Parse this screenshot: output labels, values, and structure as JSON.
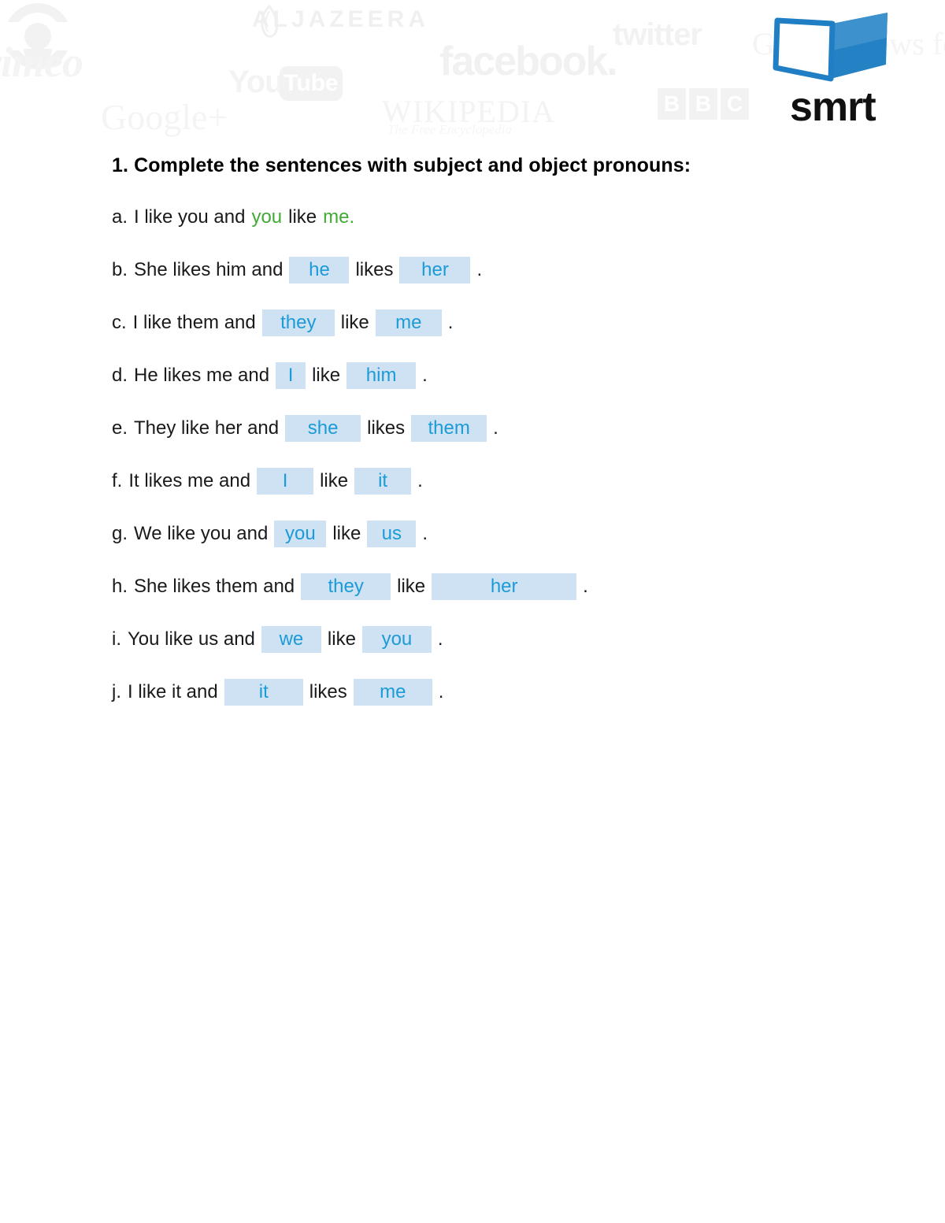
{
  "logo": {
    "brand": "smrt",
    "book_colors": {
      "left_page": "#ffffff",
      "outline": "#1f7ec4",
      "right_page": "#1f7ec4",
      "right_page_shade": "#3d92ce"
    }
  },
  "watermarks": [
    {
      "name": "vimeo",
      "text": "vimeo"
    },
    {
      "name": "cbc",
      "text": ""
    },
    {
      "name": "aljazeera",
      "text": "ALJAZEERA"
    },
    {
      "name": "youtube",
      "text": "You",
      "badge": "Tube"
    },
    {
      "name": "googleplus",
      "text": "Google+"
    },
    {
      "name": "wikipedia",
      "text": "WIKIPEDIA",
      "subtitle": "The Free Encyclopedia"
    },
    {
      "name": "facebook",
      "text": "facebook."
    },
    {
      "name": "twitter",
      "text": "twitter"
    },
    {
      "name": "googlenews",
      "text": "Google News for B"
    },
    {
      "name": "bbc",
      "letters": [
        "B",
        "B",
        "C"
      ]
    }
  ],
  "worksheet": {
    "heading": "1. Complete the sentences with subject and object pronouns:",
    "colors": {
      "answer_text": "#1b9bd8",
      "answer_highlight": "#cfe2f3",
      "example_text": "#3faa34",
      "body_text": "#1a1a1a"
    },
    "items": [
      {
        "label": "a.",
        "style": "example",
        "pre": "I like you and",
        "answer1": "you",
        "mid": "like",
        "answer2": "me",
        "post": ".",
        "answer1_width": 0,
        "answer2_width": 0
      },
      {
        "label": "b.",
        "style": "filled",
        "pre": "She likes him and",
        "answer1": "he",
        "mid": "likes",
        "answer2": "her",
        "post": ".",
        "answer1_width": 76,
        "answer2_width": 90
      },
      {
        "label": "c.",
        "style": "filled",
        "pre": "I like them and",
        "answer1": "they",
        "mid": "like",
        "answer2": "me",
        "post": ".",
        "answer1_width": 92,
        "answer2_width": 84
      },
      {
        "label": "d.",
        "style": "filled",
        "pre": "He likes me and",
        "answer1": "I",
        "mid": "like",
        "answer2": "him",
        "post": ".",
        "answer1_width": 38,
        "answer2_width": 88
      },
      {
        "label": "e.",
        "style": "filled",
        "pre": "They like her and",
        "answer1": "she",
        "mid": "likes",
        "answer2": "them",
        "post": ".",
        "answer1_width": 96,
        "answer2_width": 96
      },
      {
        "label": "f.",
        "style": "filled",
        "pre": "It likes me and",
        "answer1": "I",
        "mid": "like",
        "answer2": "it",
        "post": ".",
        "answer1_width": 72,
        "answer2_width": 72
      },
      {
        "label": "g.",
        "style": "filled",
        "pre": "We like you and",
        "answer1": "you",
        "mid": "like",
        "answer2": "us",
        "post": ".",
        "answer1_width": 66,
        "answer2_width": 62
      },
      {
        "label": "h.",
        "style": "filled",
        "pre": "She likes them and",
        "answer1": "they",
        "mid": "like",
        "answer2": "her",
        "post": ".",
        "answer1_width": 114,
        "answer2_width": 184
      },
      {
        "label": "i.",
        "style": "filled",
        "pre": "You like us and",
        "answer1": "we",
        "mid": "like",
        "answer2": "you",
        "post": ".",
        "answer1_width": 76,
        "answer2_width": 88
      },
      {
        "label": "j.",
        "style": "filled",
        "pre": "I like it and",
        "answer1": "it",
        "mid": "likes",
        "answer2": "me",
        "post": ".",
        "answer1_width": 100,
        "answer2_width": 100
      }
    ]
  }
}
